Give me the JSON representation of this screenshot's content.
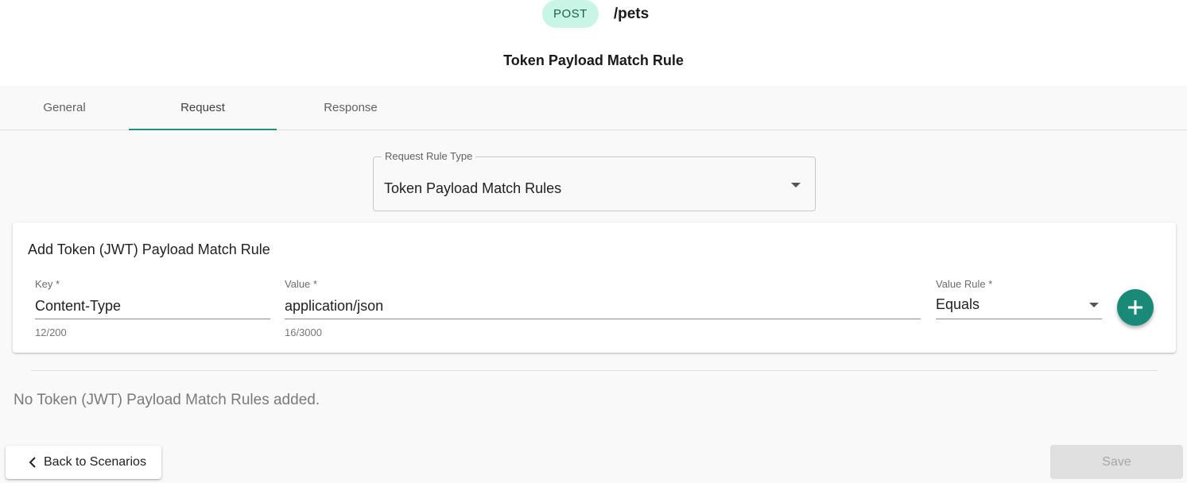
{
  "header": {
    "method": "POST",
    "path": "/pets",
    "title": "Token Payload Match Rule"
  },
  "tabs": [
    {
      "label": "General",
      "active": false
    },
    {
      "label": "Request",
      "active": true
    },
    {
      "label": "Response",
      "active": false
    }
  ],
  "request_rule_type": {
    "label": "Request Rule Type",
    "value": "Token Payload Match Rules"
  },
  "card": {
    "title": "Add Token (JWT) Payload Match Rule",
    "key": {
      "label": "Key *",
      "value": "Content-Type",
      "helper": "12/200"
    },
    "value": {
      "label": "Value *",
      "value": "application/json",
      "helper": "16/3000"
    },
    "value_rule": {
      "label": "Value Rule *",
      "value": "Equals"
    },
    "add_icon": "plus-icon"
  },
  "empty_message": "No Token (JWT) Payload Match Rules added.",
  "footer": {
    "back_label": "Back to Scenarios",
    "back_icon": "chevron-left-icon",
    "save_label": "Save"
  },
  "colors": {
    "accent": "#1a8a78",
    "method_badge_bg": "#c9f5e6",
    "disabled_bg": "#e0e0e0"
  }
}
